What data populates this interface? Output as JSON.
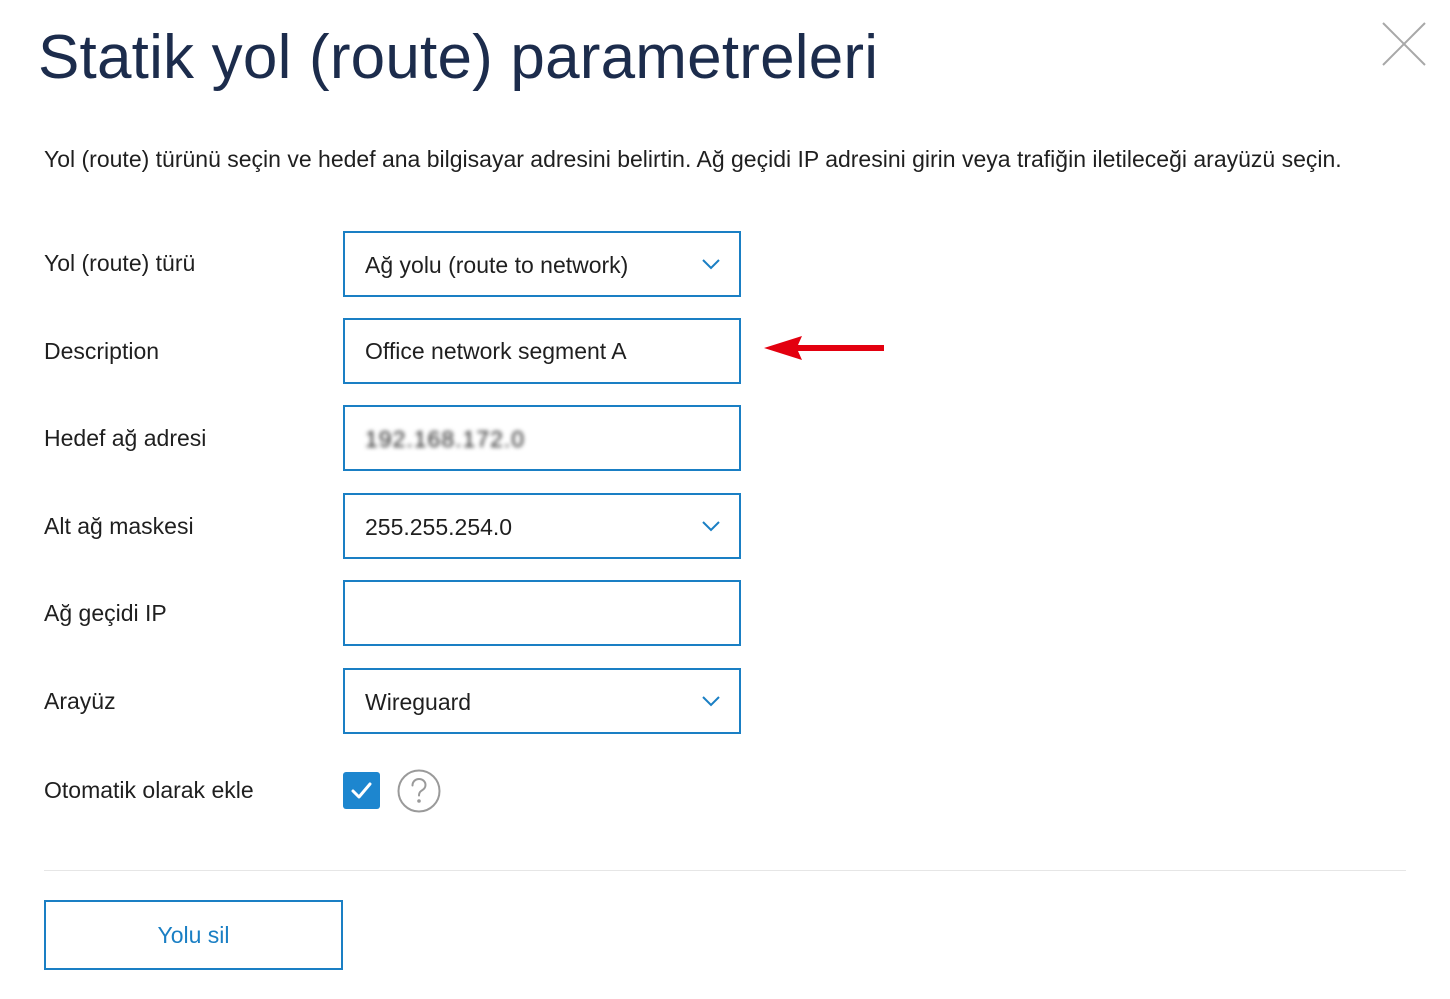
{
  "dialog": {
    "title": "Statik yol (route) parametreleri",
    "intro": "Yol (route) türünü seçin ve hedef ana bilgisayar adresini belirtin. Ağ geçidi IP adresini girin veya trafiğin iletileceği arayüzü seçin."
  },
  "form": {
    "route_type": {
      "label": "Yol (route) türü",
      "value": "Ağ yolu (route to network)"
    },
    "description": {
      "label": "Description",
      "value": "Office network segment A"
    },
    "destination": {
      "label": "Hedef ağ adresi",
      "value": "192.168.172.0"
    },
    "subnet_mask": {
      "label": "Alt ağ maskesi",
      "value": "255.255.254.0"
    },
    "gateway": {
      "label": "Ağ geçidi IP",
      "value": ""
    },
    "interface": {
      "label": "Arayüz",
      "value": "Wireguard"
    },
    "auto_add": {
      "label": "Otomatik olarak ekle",
      "checked": true
    }
  },
  "buttons": {
    "delete_label": "Yolu sil"
  },
  "colors": {
    "accent": "#1a7fc4",
    "title": "#1c2c4c",
    "annotation_arrow": "#e3000f"
  },
  "icons": {
    "close": "close-icon",
    "chevron": "chevron-down-icon",
    "check": "check-icon",
    "help": "help-icon",
    "arrow": "arrow-left-icon"
  }
}
